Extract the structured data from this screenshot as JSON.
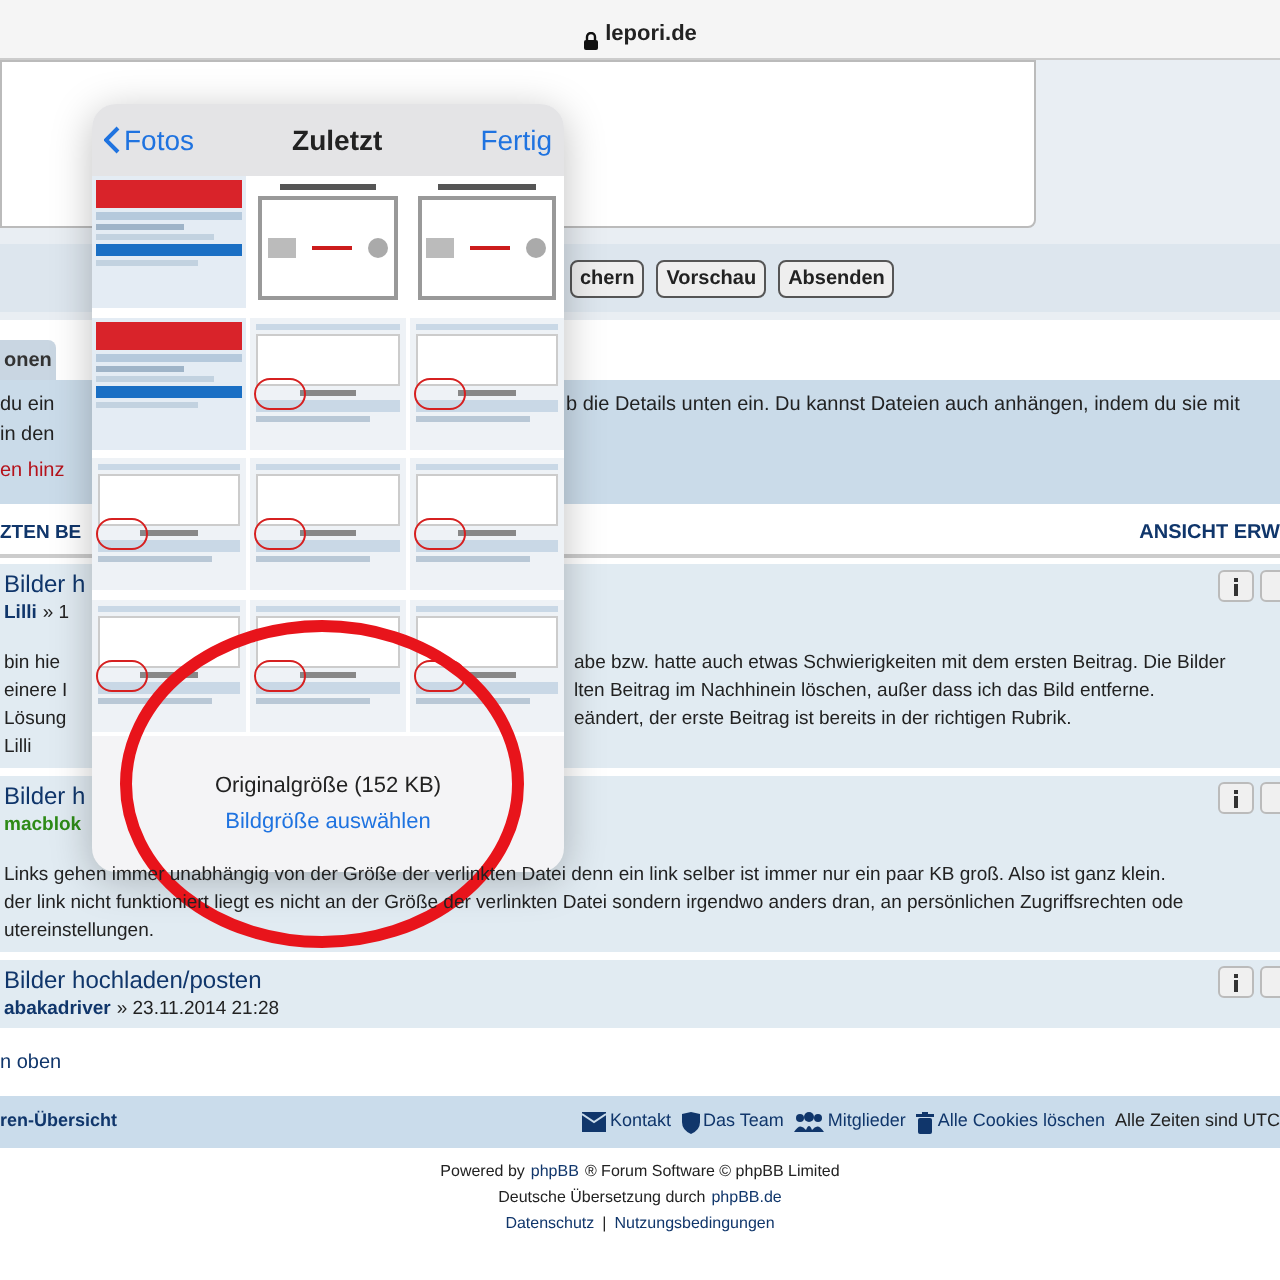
{
  "browser": {
    "address": "lepori.de"
  },
  "editor_buttons": [
    {
      "label": "chern"
    },
    {
      "label": "Vorschau"
    },
    {
      "label": "Absenden"
    }
  ],
  "tab": {
    "label": "onen"
  },
  "notice": {
    "lines": [
      {
        "left": "du ein",
        "right": "b die Details unten ein. Du kannst Dateien auch anhängen, indem du sie mit"
      },
      {
        "left": "in den"
      }
    ],
    "link": "en hinz"
  },
  "section": {
    "title": "ZTEN BE",
    "action": "ANSICHT ERW"
  },
  "posts": [
    {
      "title": "Bilder h",
      "author": "Lilli",
      "color": "#10366b",
      "meta": "» 1",
      "lines": [
        {
          "left": "bin hie",
          "right": "abe bzw. hatte auch etwas Schwierigkeiten mit dem ersten Beitrag. Die Bilder"
        },
        {
          "left": "einere I",
          "right": "lten Beitrag im Nachhinein löschen, außer dass ich das Bild entferne."
        },
        {
          "left": "Lösung",
          "right": "eändert, der erste Beitrag ist bereits in der richtigen Rubrik."
        },
        {
          "left": "Lilli"
        }
      ]
    },
    {
      "title": "Bilder h",
      "author": "macblok",
      "color": "#2e8b17",
      "lines": [
        {
          "left": "Links gehen immer unabhängig von der Größe der verlinkten Datei denn ein link selber ist immer nur ein paar KB groß. Also ist ganz klein."
        },
        {
          "left": "der link nicht funktioniert liegt es nicht an der Größe der verlinkten Datei sondern irgendwo anders dran, an persönlichen Zugriffsrechten ode"
        },
        {
          "left": "utereinstellungen."
        }
      ]
    },
    {
      "title": "Bilder hochladen/posten",
      "author": "abakadriver",
      "color": "#10366b",
      "meta": "» 23.11.2014 21:28"
    }
  ],
  "back_to_top": "n oben",
  "footer": {
    "left": "ren-Übersicht",
    "links": [
      {
        "kind": "contact",
        "label": "Kontakt"
      },
      {
        "kind": "team",
        "label": "Das Team"
      },
      {
        "kind": "members",
        "label": "Mitglieder"
      },
      {
        "kind": "cookies",
        "label": "Alle Cookies löschen"
      }
    ],
    "timezone": "Alle Zeiten sind UTC"
  },
  "credits": [
    {
      "before": "Powered by",
      "link": "phpBB",
      "after": "® Forum Software © phpBB Limited"
    },
    {
      "before": "Deutsche Übersetzung durch",
      "link": "phpBB.de"
    }
  ],
  "legal_links": [
    "Datenschutz",
    "Nutzungsbedingungen"
  ],
  "legal_separator": "|",
  "photo_picker": {
    "back": "Fotos",
    "title": "Zuletzt",
    "done": "Fertig",
    "thumbnails": [
      {
        "kind": "forum"
      },
      {
        "kind": "diagram"
      },
      {
        "kind": "diagram"
      },
      {
        "kind": "forum"
      },
      {
        "kind": "post"
      },
      {
        "kind": "post"
      },
      {
        "kind": "post"
      },
      {
        "kind": "post"
      },
      {
        "kind": "post"
      },
      {
        "kind": "post"
      },
      {
        "kind": "post"
      },
      {
        "kind": "post"
      }
    ],
    "size_label": "Originalgröße (152 KB)",
    "size_action": "Bildgröße auswählen"
  }
}
